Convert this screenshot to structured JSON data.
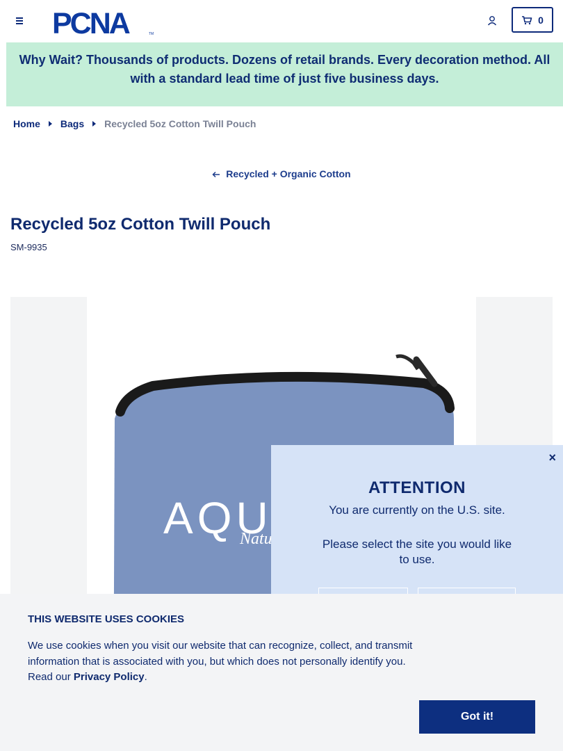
{
  "header": {
    "logo_text": "PCNA",
    "logo_tm": "TM",
    "cart_count": "0"
  },
  "promo": {
    "text": "Why Wait? Thousands of products. Dozens of retail brands. Every decoration method. All with a standard lead time of just five business days."
  },
  "breadcrumb": {
    "home": "Home",
    "bags": "Bags",
    "current": "Recycled 5oz Cotton Twill Pouch"
  },
  "back_link": {
    "label": "Recycled + Organic Cotton"
  },
  "product": {
    "title": "Recycled 5oz Cotton Twill Pouch",
    "sku": "SM-9935",
    "imprint_text": "AQU",
    "imprint_sub": "Natu"
  },
  "attention": {
    "close": "×",
    "title": "ATTENTION",
    "line1": "You are currently on the U.S. site.",
    "line2": "Please select the site you would like to use."
  },
  "cookie": {
    "title": "THIS WEBSITE USES COOKIES",
    "text": "We use cookies when you visit our website that can recognize, collect, and transmit information that is associated with you, but which does not personally identify you. Read our ",
    "link": "Privacy Policy",
    "period": ".",
    "button": "Got it!"
  },
  "colors": {
    "brand_navy": "#0d2a7a",
    "promo_bg": "#c4eed8",
    "attention_bg": "#d6e3f7",
    "cookie_bg": "#f3f4f6",
    "pouch_blue": "#7b93c0"
  }
}
